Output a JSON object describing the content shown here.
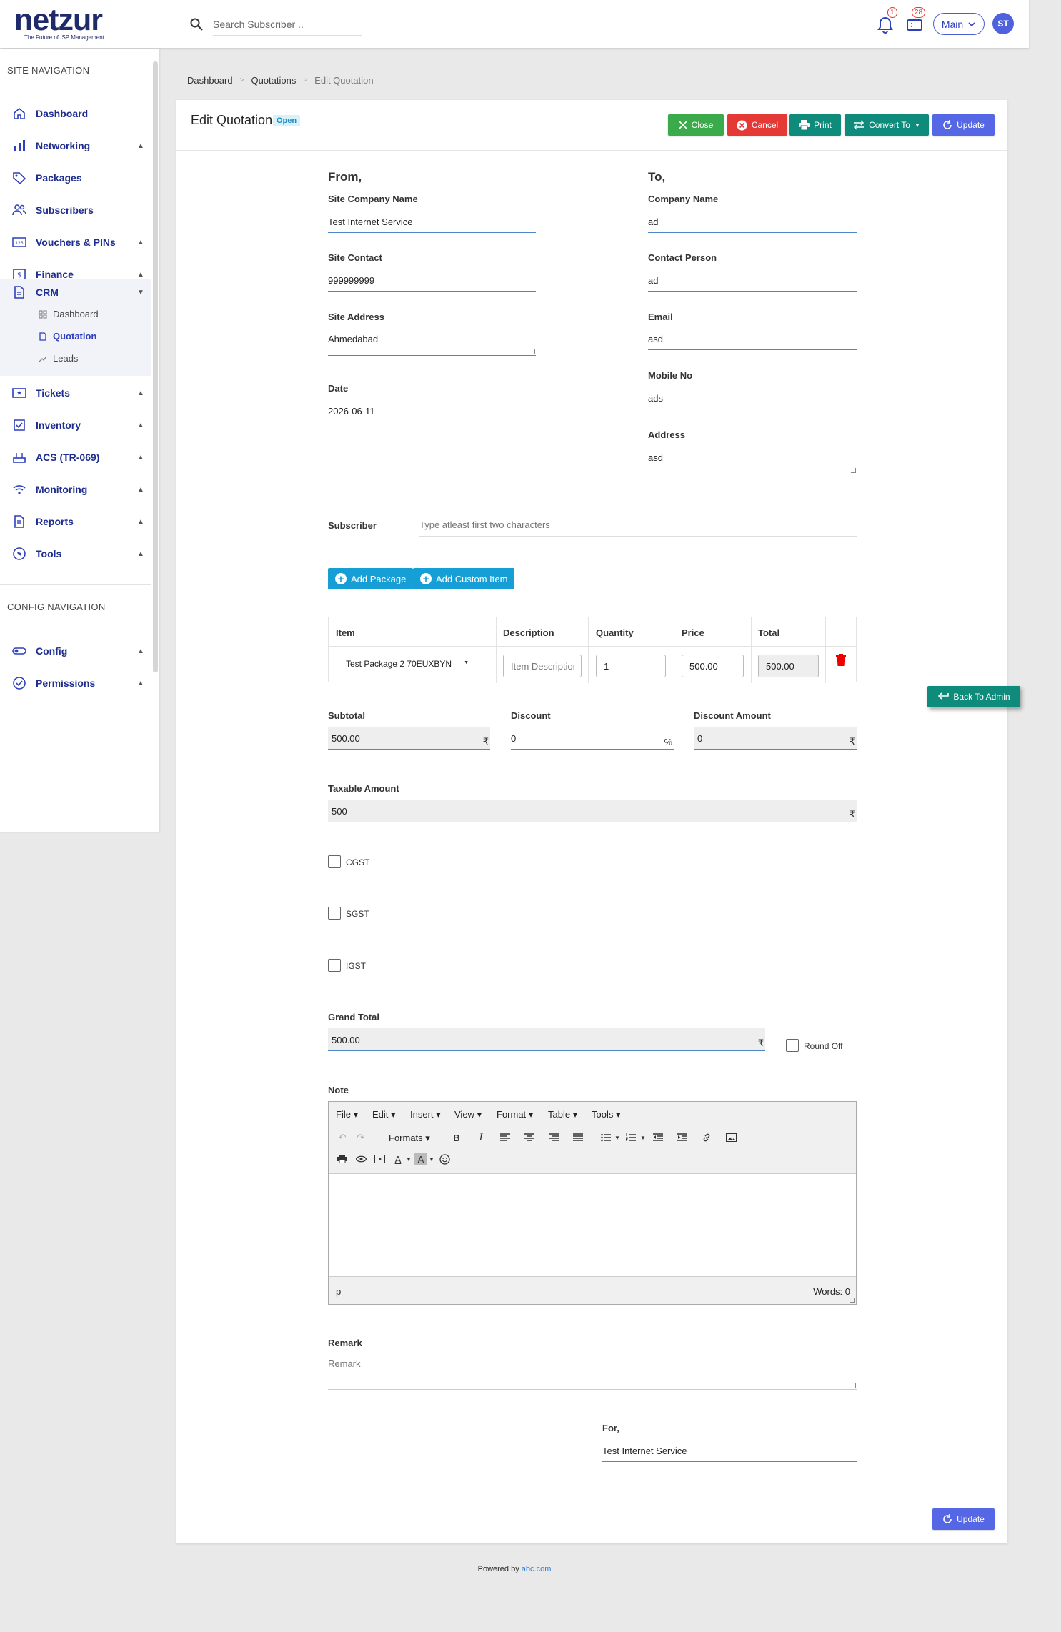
{
  "header": {
    "logo": "netzur",
    "logo_tagline": "The Future of ISP Management",
    "search_placeholder": "Search Subscriber ..",
    "notifications_count": "1",
    "tickets_count": "28",
    "branch": "Main",
    "avatar_initials": "ST"
  },
  "sidebar": {
    "site_title": "SITE NAVIGATION",
    "config_title": "CONFIG NAVIGATION",
    "items": {
      "dashboard": "Dashboard",
      "networking": "Networking",
      "packages": "Packages",
      "subscribers": "Subscribers",
      "vouchers": "Vouchers & PINs",
      "finance": "Finance",
      "crm": "CRM",
      "tickets": "Tickets",
      "inventory": "Inventory",
      "acs": "ACS (TR-069)",
      "monitoring": "Monitoring",
      "reports": "Reports",
      "tools": "Tools",
      "config": "Config",
      "permissions": "Permissions"
    },
    "crm_sub": {
      "dashboard": "Dashboard",
      "quotation": "Quotation",
      "leads": "Leads"
    }
  },
  "breadcrumb": {
    "home": "Dashboard",
    "parent": "Quotations",
    "current": "Edit Quotation"
  },
  "page": {
    "title": "Edit Quotation",
    "status": "Open",
    "buttons": {
      "close": "Close",
      "cancel": "Cancel",
      "print": "Print",
      "convert": "Convert To",
      "update": "Update"
    }
  },
  "from": {
    "heading": "From,",
    "company_label": "Site Company Name",
    "company_value": "Test Internet Service",
    "contact_label": "Site Contact",
    "contact_value": "999999999",
    "address_label": "Site Address",
    "address_value": "Ahmedabad",
    "date_label": "Date",
    "date_value": "2026-06-11"
  },
  "to": {
    "heading": "To,",
    "company_label": "Company Name",
    "company_value": "ad",
    "person_label": "Contact Person",
    "person_value": "ad",
    "email_label": "Email",
    "email_value": "asd",
    "mobile_label": "Mobile No",
    "mobile_value": "ads",
    "address_label": "Address",
    "address_value": "asd"
  },
  "subscriber": {
    "label": "Subscriber",
    "placeholder": "Type atleast first two characters"
  },
  "add_buttons": {
    "package": "Add Package",
    "custom": "Add Custom Item"
  },
  "table": {
    "headers": [
      "Item",
      "Description",
      "Quantity",
      "Price",
      "Total"
    ],
    "rows": [
      {
        "item": "Test Package 2 70EUXBYN",
        "description_placeholder": "Item Description",
        "quantity": "1",
        "price": "500.00",
        "total": "500.00"
      }
    ]
  },
  "totals": {
    "subtotal_label": "Subtotal",
    "subtotal_value": "500.00",
    "discount_label": "Discount",
    "discount_value": "0",
    "discount_unit": "%",
    "discount_amount_label": "Discount Amount",
    "discount_amount_value": "0",
    "taxable_label": "Taxable Amount",
    "taxable_value": "500",
    "currency": "₹",
    "cgst": "CGST",
    "sgst": "SGST",
    "igst": "IGST",
    "grand_label": "Grand Total",
    "grand_value": "500.00",
    "round_off": "Round Off"
  },
  "note": {
    "label": "Note",
    "menus": [
      "File",
      "Edit",
      "Insert",
      "View",
      "Format",
      "Table",
      "Tools"
    ],
    "formats": "Formats",
    "path": "p",
    "words": "Words: 0"
  },
  "remark": {
    "label": "Remark",
    "placeholder": "Remark"
  },
  "for": {
    "label": "For,",
    "value": "Test Internet Service"
  },
  "back_to_admin": "Back To Admin",
  "footer": {
    "text": "Powered by",
    "link": "abc.com"
  },
  "colors": {
    "brand": "#1f2a6b",
    "nav": "#1e2d8f",
    "green": "#3aaa4a",
    "red": "#e53935",
    "teal": "#0f8b7b",
    "blue": "#5567e5",
    "info": "#159fd6"
  }
}
